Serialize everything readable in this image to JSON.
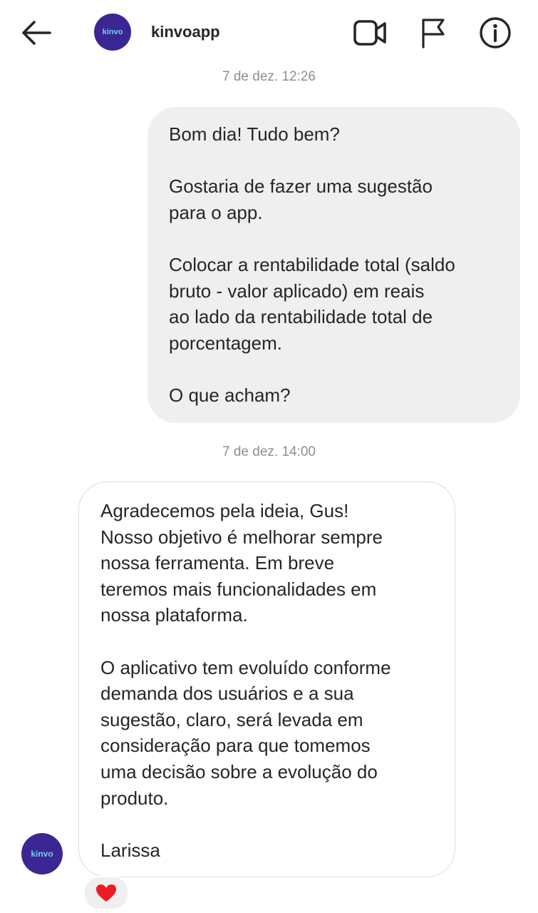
{
  "header": {
    "username": "kinvoapp",
    "avatar_text": "kinvo",
    "back_icon": "arrow-left-icon",
    "video_icon": "video-camera-icon",
    "flag_icon": "flag-icon",
    "info_icon": "info-icon"
  },
  "conversation": {
    "timestamp_1": "7 de dez. 12:26",
    "outgoing_message": "Bom dia! Tudo bem?\n\nGostaria de fazer uma sugestão\npara o app.\n\nColocar a rentabilidade total (saldo\nbruto - valor aplicado) em reais\nao lado da rentabilidade total de\nporcentagem.\n\nO que acham?",
    "timestamp_2": "7 de dez. 14:00",
    "incoming_message": "Agradecemos pela ideia, Gus!\nNosso objetivo é melhorar sempre\nnossa ferramenta. Em breve\nteremos mais funcionalidades em\nnossa plataforma.\n\nO aplicativo tem evoluído conforme\ndemanda dos usuários e a sua\nsugestão, claro, será levada em\nconsideração para que tomemos\numa decisão sobre a evolução do\nproduto.\n\nLarissa",
    "sender_avatar_text": "kinvo",
    "reaction": "heart-icon"
  },
  "colors": {
    "avatar_bg": "#3b2694",
    "avatar_text": "#6fd3f0",
    "outgoing_bubble": "#efefef",
    "incoming_border": "#dbdbdb",
    "heart": "#ed1c24"
  }
}
